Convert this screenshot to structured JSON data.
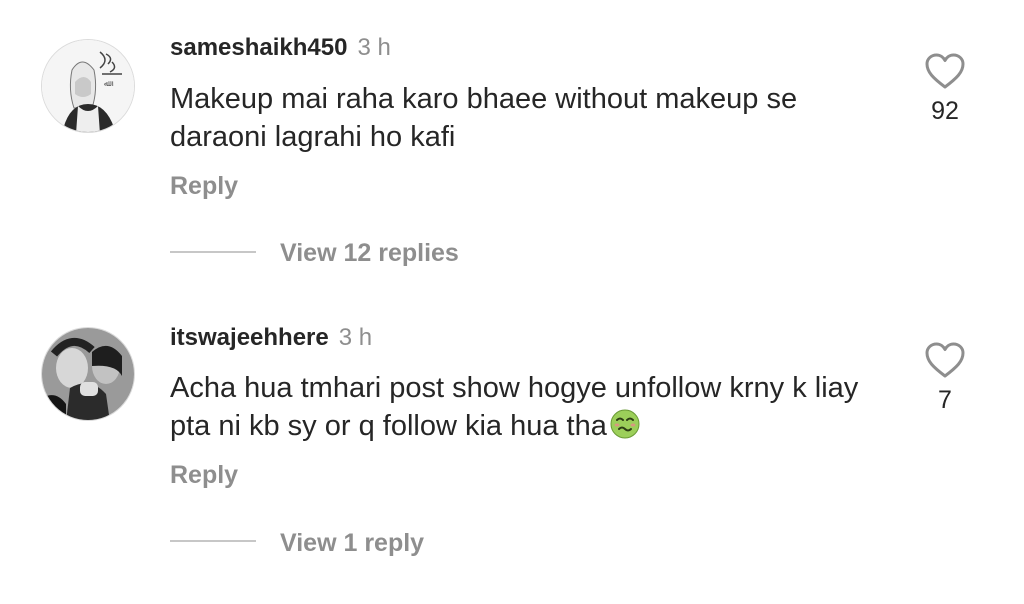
{
  "comments": [
    {
      "username": "sameshaikh450",
      "time": "3 h",
      "text": "Makeup mai raha karo bhaee without makeup se daraoni lagrahi ho kafi",
      "likes": "92",
      "reply_label": "Reply",
      "view_replies": "View 12 replies",
      "avatar": "hijab-calligraphy-avatar"
    },
    {
      "username": "itswajeehhere",
      "time": "3 h",
      "text": "Acha hua tmhari post show hogye unfollow krny k liay pta ni kb sy or q follow kia hua tha",
      "emoji": "nauseated-face-emoji",
      "likes": "7",
      "reply_label": "Reply",
      "view_replies": "View 1 reply",
      "avatar": "grayscale-couple-avatar"
    }
  ],
  "icons": {
    "like": "heart-outline-icon"
  },
  "colors": {
    "primary_text": "#262626",
    "secondary_text": "#8e8e8e",
    "divider": "#c7c7c7"
  }
}
